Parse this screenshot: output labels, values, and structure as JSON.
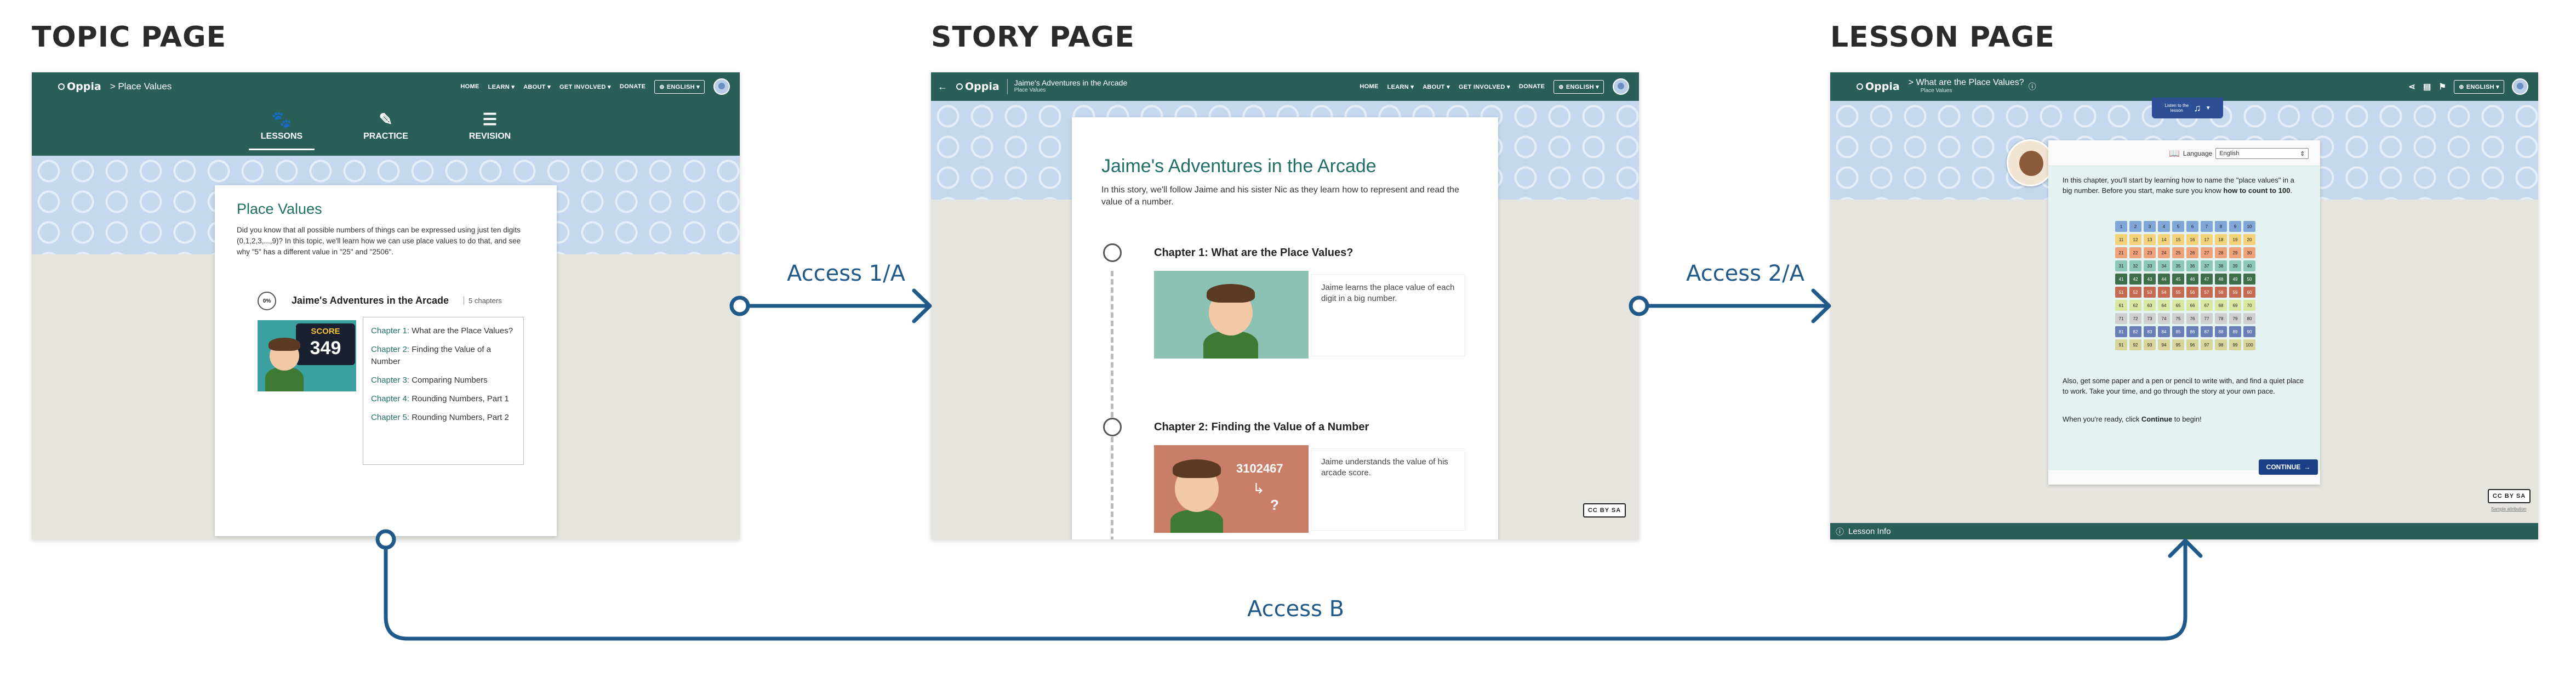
{
  "sections": {
    "topic": "TOPIC PAGE",
    "story": "STORY PAGE",
    "lesson": "LESSON PAGE"
  },
  "arrows": {
    "access_1a": "Access 1/A",
    "access_2a": "Access 2/A",
    "access_b": "Access B"
  },
  "nav": {
    "logo": "Oppia",
    "home": "HOME",
    "learn": "LEARN ▾",
    "about": "ABOUT ▾",
    "get_involved": "GET INVOLVED ▾",
    "donate": "DONATE",
    "language": "ENGLISH ▾"
  },
  "topic_page": {
    "breadcrumb": "> Place Values",
    "tabs": [
      "LESSONS",
      "PRACTICE",
      "REVISION"
    ],
    "title": "Place Values",
    "description": "Did you know that all possible numbers of things can be expressed using just ten digits (0,1,2,3,...,9)? In this topic, we'll learn how we can use place values to do that, and see why \"5\" has a different value in \"25\" and \"2506\".",
    "progress": "0%",
    "story_title": "Jaime's Adventures in the Arcade",
    "chapter_count": "5 chapters",
    "score_label": "SCORE",
    "score_value": "349",
    "chapters": [
      {
        "num": "Chapter 1:",
        "title": "What are the Place Values?"
      },
      {
        "num": "Chapter 2:",
        "title": "Finding the Value of a Number"
      },
      {
        "num": "Chapter 3:",
        "title": "Comparing Numbers"
      },
      {
        "num": "Chapter 4:",
        "title": "Rounding Numbers, Part 1"
      },
      {
        "num": "Chapter 5:",
        "title": "Rounding Numbers, Part 2"
      }
    ]
  },
  "story_page": {
    "header_title": "Jaime's Adventures in the Arcade",
    "header_sub": "Place Values",
    "title": "Jaime's Adventures in the Arcade",
    "description": "In this story, we'll follow Jaime and his sister Nic as they learn how to represent and read the value of a number.",
    "chapters": [
      {
        "heading": "Chapter 1: What are the Place Values?",
        "summary": "Jaime learns the place value of each digit in a big number."
      },
      {
        "heading": "Chapter 2: Finding the Value of a Number",
        "summary": "Jaime understands the value of his arcade score."
      }
    ],
    "arcade_number": "3102467",
    "question_mark": "?"
  },
  "lesson_page": {
    "breadcrumb": "> What are the Place Values?",
    "breadcrumb_sub": "Place Values",
    "listen_label": "Listen to the lesson",
    "language_label": "Language",
    "language_value": "English",
    "intro_text": "In this chapter, you'll start by learning how to name the \"place values\" in a big number.  Before you start, make sure you know ",
    "intro_bold": "how to count to 100",
    "intro_end": ".",
    "paper_text": "Also, get some paper and a pen or pencil to write with, and find a quiet place to work. Take your time, and go through the story at your own pace.",
    "ready_text": "When you're ready, click ",
    "ready_bold": "Continue",
    "ready_end": " to begin!",
    "continue": "CONTINUE",
    "lesson_info": "Lesson Info",
    "attribution": "Sample attribution",
    "cc": "CC BY SA"
  },
  "colors": {
    "nav": "#2a5f57",
    "arrow": "#1f5a8a",
    "grid_rows": [
      "#7fa6d6",
      "#f3d27a",
      "#f0a27a",
      "#8cc7b7",
      "#3f6e4a",
      "#c76a52",
      "#d9e7a0",
      "#cfcfcf",
      "#6a7fb8",
      "#d8d59a"
    ]
  }
}
